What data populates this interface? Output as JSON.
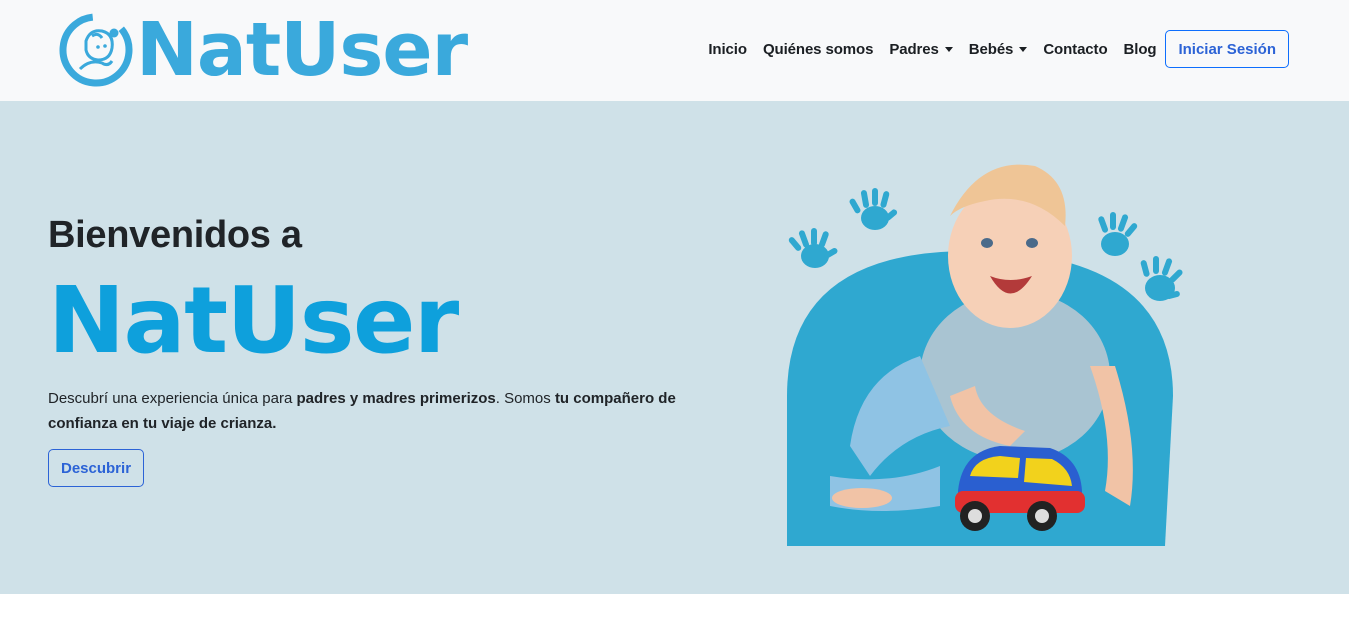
{
  "brand": {
    "name": "NatUser",
    "logo_icon": "baby-face-logo-icon",
    "color": "#3aa9dc"
  },
  "nav": {
    "items": [
      {
        "label": "Inicio",
        "dropdown": false
      },
      {
        "label": "Quiénes somos",
        "dropdown": false
      },
      {
        "label": "Padres",
        "dropdown": true
      },
      {
        "label": "Bebés",
        "dropdown": true
      },
      {
        "label": "Contacto",
        "dropdown": false
      },
      {
        "label": "Blog",
        "dropdown": false
      }
    ],
    "login_label": "Iniciar Sesión",
    "accent": "#0d6efd"
  },
  "hero": {
    "welcome": "Bienvenidos a",
    "title": "NatUser",
    "desc_part1": "Descubrí una experiencia única para ",
    "desc_bold1": "padres y madres primerizos",
    "desc_part2": ". Somos ",
    "desc_bold2": "tu compañero de confianza en tu viaje de crianza.",
    "cta_label": "Descubrir",
    "background": "#cfe1e8",
    "image_icons": [
      "baby-with-toy-car-image",
      "hand-print-icon"
    ]
  }
}
